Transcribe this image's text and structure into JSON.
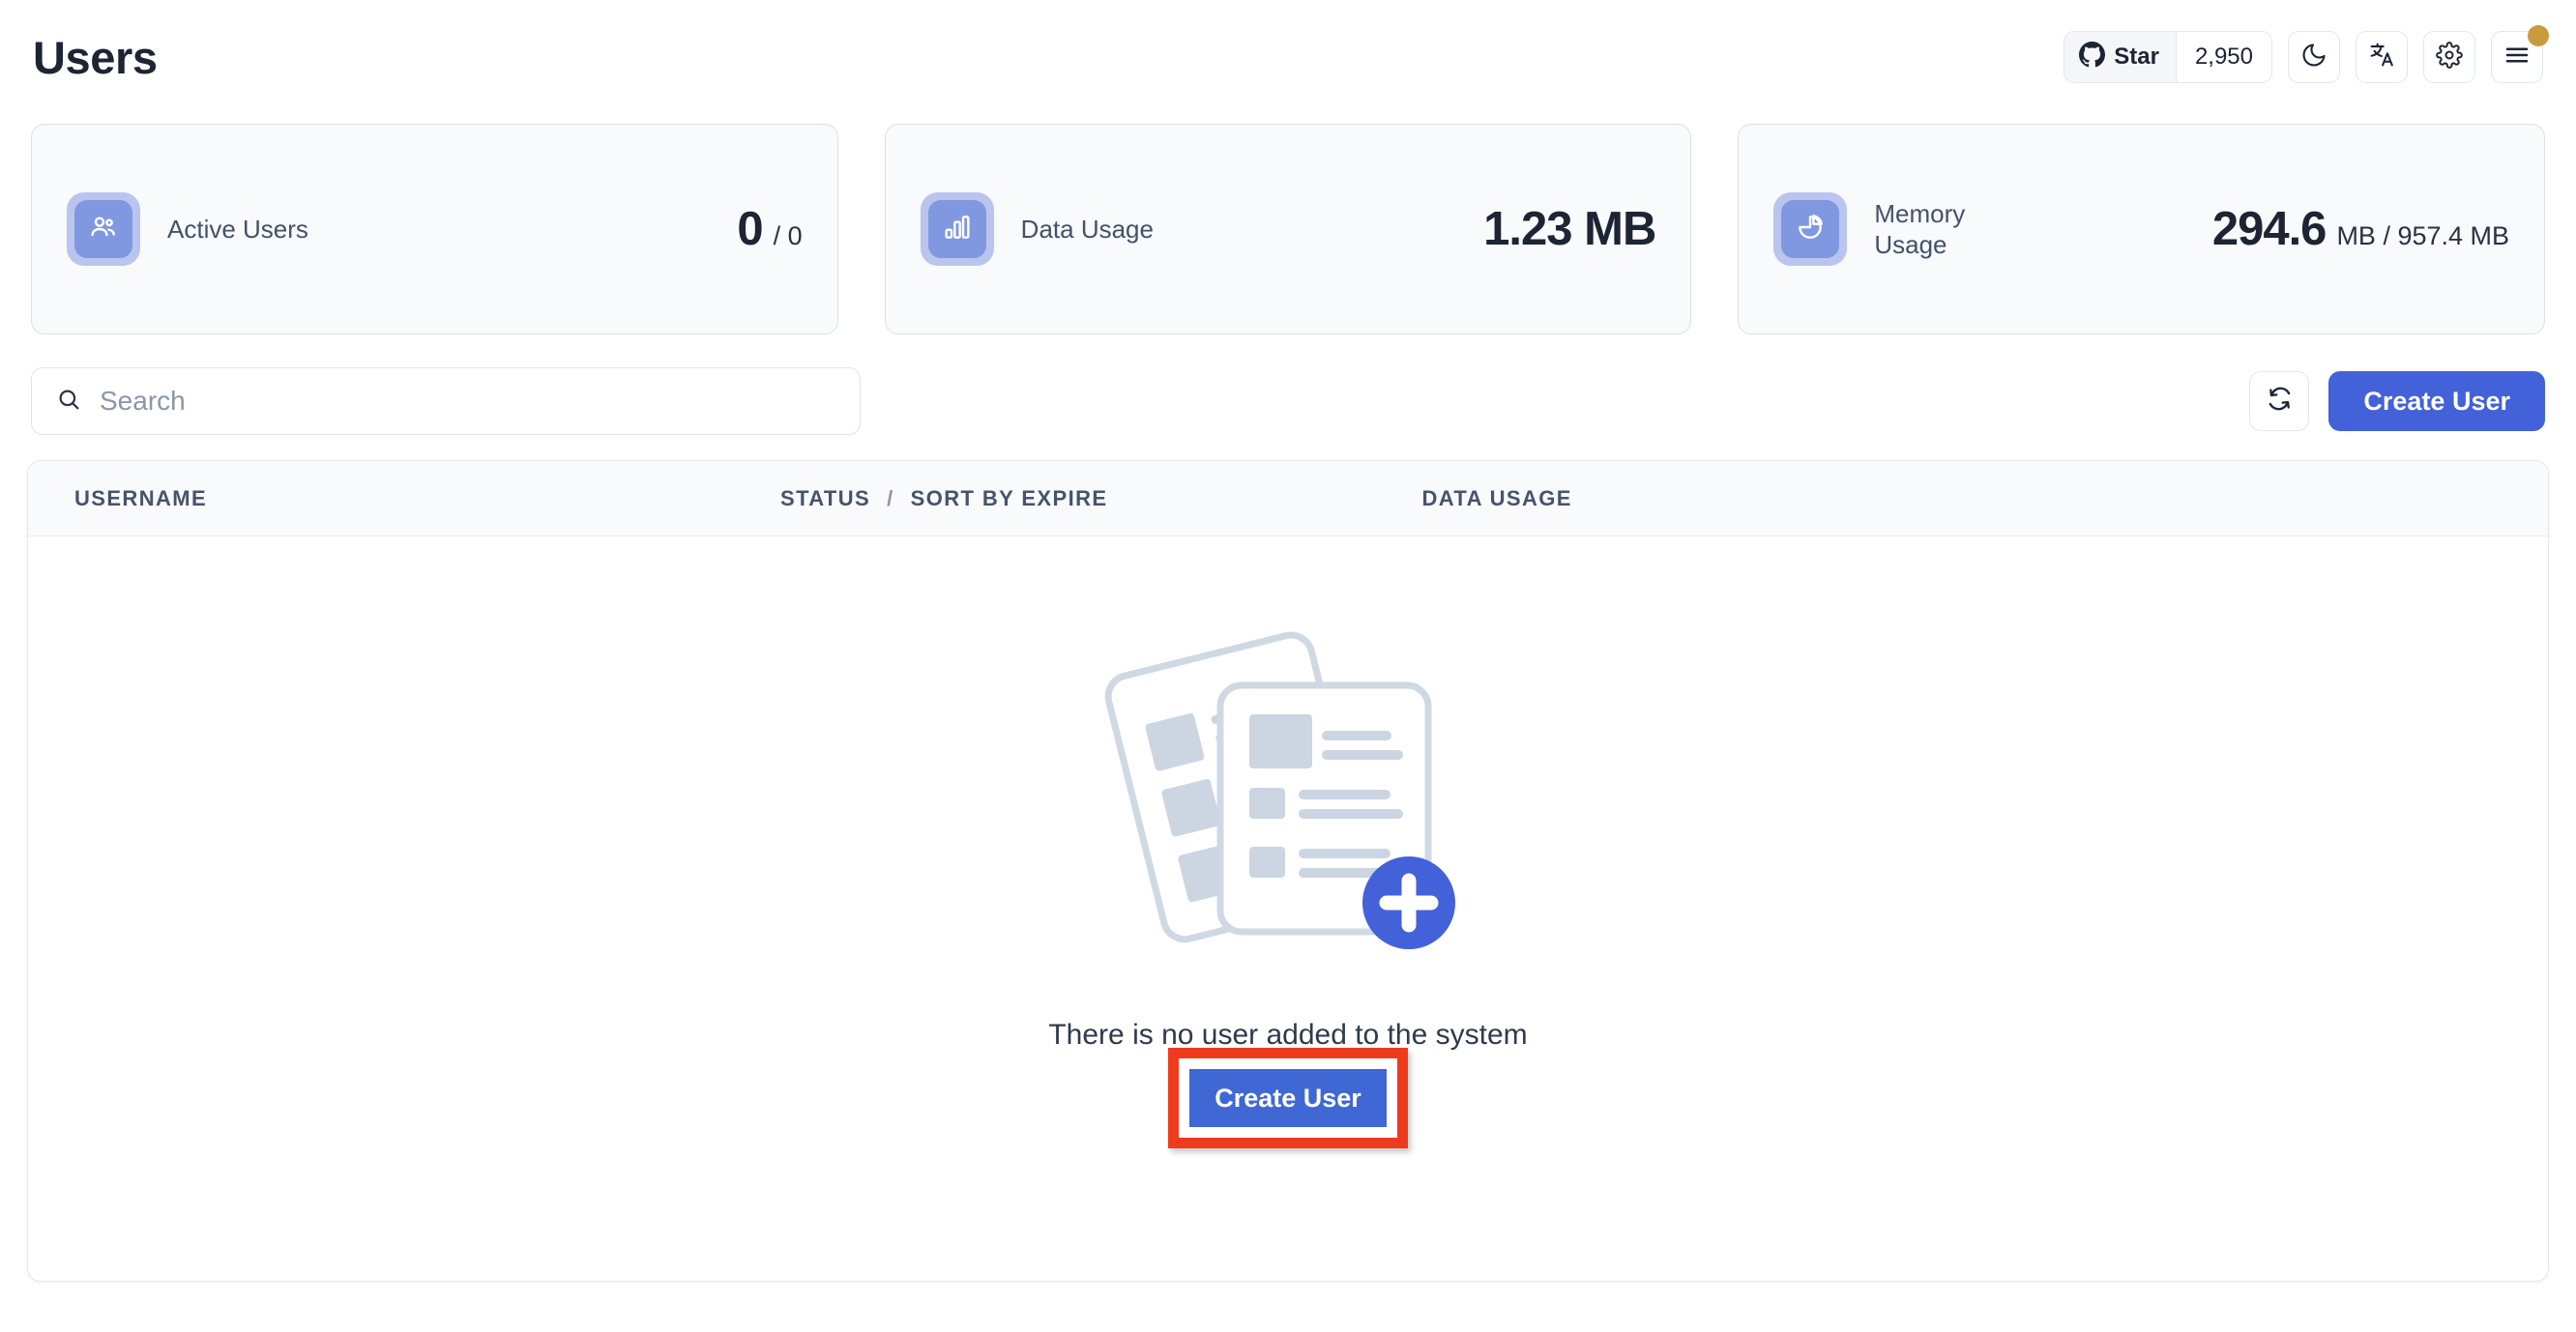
{
  "header": {
    "title": "Users",
    "github": {
      "icon": "github-icon",
      "label": "Star",
      "count": "2,950"
    },
    "buttons": [
      {
        "name": "dark-mode-toggle",
        "icon": "moon-icon"
      },
      {
        "name": "language-button",
        "icon": "translate-icon"
      },
      {
        "name": "settings-button",
        "icon": "gear-icon"
      },
      {
        "name": "menu-button",
        "icon": "hamburger-icon",
        "badge": true
      }
    ]
  },
  "stats": [
    {
      "label": "Active Users",
      "icon": "users-icon",
      "value": "0",
      "suffix": "/ 0"
    },
    {
      "label": "Data Usage",
      "icon": "bar-chart-icon",
      "value": "1.23 MB",
      "suffix": ""
    },
    {
      "label": "Memory Usage",
      "icon": "pie-chart-icon",
      "value": "294.6",
      "suffix": "MB / 957.4 MB"
    }
  ],
  "toolbar": {
    "search_placeholder": "Search",
    "search_value": "",
    "refresh_icon": "refresh-icon",
    "create_user_label": "Create User"
  },
  "table": {
    "columns": [
      {
        "key": "username",
        "label": "USERNAME"
      },
      {
        "key": "status",
        "label": "STATUS"
      },
      {
        "key": "separator",
        "label": "/"
      },
      {
        "key": "expire",
        "label": "SORT BY EXPIRE"
      },
      {
        "key": "data_usage",
        "label": "DATA USAGE"
      }
    ],
    "rows": []
  },
  "empty_state": {
    "illustration": "empty-documents-add-icon",
    "message": "There is no user added to the system",
    "create_user_label": "Create User",
    "highlight_color": "#ee3b1e"
  },
  "colors": {
    "primary": "#4361d8",
    "card_bg": "#f8fafb",
    "badge": "#c99a3e",
    "text": "#1d2433"
  }
}
